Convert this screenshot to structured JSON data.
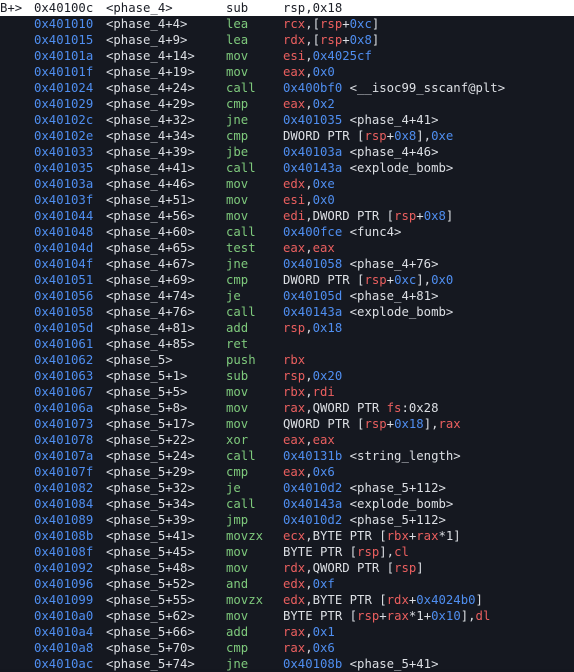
{
  "gutter_marker": "B+>",
  "lines": [
    {
      "addr": "0x40100c",
      "sym": "<phase_4>",
      "mn": "sub",
      "ops": [
        {
          "t": "rsp",
          "k": "plain"
        },
        {
          "t": ",",
          "k": "plain"
        },
        {
          "t": "0x18",
          "k": "plain"
        }
      ],
      "current": true
    },
    {
      "addr": "0x401010",
      "sym": "<phase_4+4>",
      "mn": "lea",
      "ops": [
        {
          "t": "rcx",
          "k": "reg"
        },
        {
          "t": ",[",
          "k": "plain"
        },
        {
          "t": "rsp",
          "k": "reg"
        },
        {
          "t": "+",
          "k": "plain"
        },
        {
          "t": "0xc",
          "k": "num"
        },
        {
          "t": "]",
          "k": "plain"
        }
      ]
    },
    {
      "addr": "0x401015",
      "sym": "<phase_4+9>",
      "mn": "lea",
      "ops": [
        {
          "t": "rdx",
          "k": "reg"
        },
        {
          "t": ",[",
          "k": "plain"
        },
        {
          "t": "rsp",
          "k": "reg"
        },
        {
          "t": "+",
          "k": "plain"
        },
        {
          "t": "0x8",
          "k": "num"
        },
        {
          "t": "]",
          "k": "plain"
        }
      ]
    },
    {
      "addr": "0x40101a",
      "sym": "<phase_4+14>",
      "mn": "mov",
      "ops": [
        {
          "t": "esi",
          "k": "reg"
        },
        {
          "t": ",",
          "k": "plain"
        },
        {
          "t": "0x4025cf",
          "k": "num"
        }
      ]
    },
    {
      "addr": "0x40101f",
      "sym": "<phase_4+19>",
      "mn": "mov",
      "ops": [
        {
          "t": "eax",
          "k": "reg"
        },
        {
          "t": ",",
          "k": "plain"
        },
        {
          "t": "0x0",
          "k": "num"
        }
      ]
    },
    {
      "addr": "0x401024",
      "sym": "<phase_4+24>",
      "mn": "call",
      "ops": [
        {
          "t": "0x400bf0",
          "k": "num"
        },
        {
          "t": " <__isoc99_sscanf@plt>",
          "k": "plain"
        }
      ]
    },
    {
      "addr": "0x401029",
      "sym": "<phase_4+29>",
      "mn": "cmp",
      "ops": [
        {
          "t": "eax",
          "k": "reg"
        },
        {
          "t": ",",
          "k": "plain"
        },
        {
          "t": "0x2",
          "k": "num"
        }
      ]
    },
    {
      "addr": "0x40102c",
      "sym": "<phase_4+32>",
      "mn": "jne",
      "ops": [
        {
          "t": "0x401035",
          "k": "num"
        },
        {
          "t": " <phase_4+41>",
          "k": "plain"
        }
      ]
    },
    {
      "addr": "0x40102e",
      "sym": "<phase_4+34>",
      "mn": "cmp",
      "ops": [
        {
          "t": "DWORD PTR [",
          "k": "plain"
        },
        {
          "t": "rsp",
          "k": "reg"
        },
        {
          "t": "+",
          "k": "plain"
        },
        {
          "t": "0x8",
          "k": "num"
        },
        {
          "t": "],",
          "k": "plain"
        },
        {
          "t": "0xe",
          "k": "num"
        }
      ]
    },
    {
      "addr": "0x401033",
      "sym": "<phase_4+39>",
      "mn": "jbe",
      "ops": [
        {
          "t": "0x40103a",
          "k": "num"
        },
        {
          "t": " <phase_4+46>",
          "k": "plain"
        }
      ]
    },
    {
      "addr": "0x401035",
      "sym": "<phase_4+41>",
      "mn": "call",
      "ops": [
        {
          "t": "0x40143a",
          "k": "num"
        },
        {
          "t": " <explode_bomb>",
          "k": "plain"
        }
      ]
    },
    {
      "addr": "0x40103a",
      "sym": "<phase_4+46>",
      "mn": "mov",
      "ops": [
        {
          "t": "edx",
          "k": "reg"
        },
        {
          "t": ",",
          "k": "plain"
        },
        {
          "t": "0xe",
          "k": "num"
        }
      ]
    },
    {
      "addr": "0x40103f",
      "sym": "<phase_4+51>",
      "mn": "mov",
      "ops": [
        {
          "t": "esi",
          "k": "reg"
        },
        {
          "t": ",",
          "k": "plain"
        },
        {
          "t": "0x0",
          "k": "num"
        }
      ]
    },
    {
      "addr": "0x401044",
      "sym": "<phase_4+56>",
      "mn": "mov",
      "ops": [
        {
          "t": "edi",
          "k": "reg"
        },
        {
          "t": ",DWORD PTR [",
          "k": "plain"
        },
        {
          "t": "rsp",
          "k": "reg"
        },
        {
          "t": "+",
          "k": "plain"
        },
        {
          "t": "0x8",
          "k": "num"
        },
        {
          "t": "]",
          "k": "plain"
        }
      ]
    },
    {
      "addr": "0x401048",
      "sym": "<phase_4+60>",
      "mn": "call",
      "ops": [
        {
          "t": "0x400fce",
          "k": "num"
        },
        {
          "t": " <func4>",
          "k": "plain"
        }
      ]
    },
    {
      "addr": "0x40104d",
      "sym": "<phase_4+65>",
      "mn": "test",
      "ops": [
        {
          "t": "eax",
          "k": "reg"
        },
        {
          "t": ",",
          "k": "plain"
        },
        {
          "t": "eax",
          "k": "reg"
        }
      ]
    },
    {
      "addr": "0x40104f",
      "sym": "<phase_4+67>",
      "mn": "jne",
      "ops": [
        {
          "t": "0x401058",
          "k": "num"
        },
        {
          "t": " <phase_4+76>",
          "k": "plain"
        }
      ]
    },
    {
      "addr": "0x401051",
      "sym": "<phase_4+69>",
      "mn": "cmp",
      "ops": [
        {
          "t": "DWORD PTR [",
          "k": "plain"
        },
        {
          "t": "rsp",
          "k": "reg"
        },
        {
          "t": "+",
          "k": "plain"
        },
        {
          "t": "0xc",
          "k": "num"
        },
        {
          "t": "],",
          "k": "plain"
        },
        {
          "t": "0x0",
          "k": "num"
        }
      ]
    },
    {
      "addr": "0x401056",
      "sym": "<phase_4+74>",
      "mn": "je",
      "ops": [
        {
          "t": "0x40105d",
          "k": "num"
        },
        {
          "t": " <phase_4+81>",
          "k": "plain"
        }
      ]
    },
    {
      "addr": "0x401058",
      "sym": "<phase_4+76>",
      "mn": "call",
      "ops": [
        {
          "t": "0x40143a",
          "k": "num"
        },
        {
          "t": " <explode_bomb>",
          "k": "plain"
        }
      ]
    },
    {
      "addr": "0x40105d",
      "sym": "<phase_4+81>",
      "mn": "add",
      "ops": [
        {
          "t": "rsp",
          "k": "reg"
        },
        {
          "t": ",",
          "k": "plain"
        },
        {
          "t": "0x18",
          "k": "num"
        }
      ]
    },
    {
      "addr": "0x401061",
      "sym": "<phase_4+85>",
      "mn": "ret",
      "ops": []
    },
    {
      "addr": "0x401062",
      "sym": "<phase_5>",
      "mn": "push",
      "ops": [
        {
          "t": "rbx",
          "k": "reg"
        }
      ]
    },
    {
      "addr": "0x401063",
      "sym": "<phase_5+1>",
      "mn": "sub",
      "ops": [
        {
          "t": "rsp",
          "k": "reg"
        },
        {
          "t": ",",
          "k": "plain"
        },
        {
          "t": "0x20",
          "k": "num"
        }
      ]
    },
    {
      "addr": "0x401067",
      "sym": "<phase_5+5>",
      "mn": "mov",
      "ops": [
        {
          "t": "rbx",
          "k": "reg"
        },
        {
          "t": ",",
          "k": "plain"
        },
        {
          "t": "rdi",
          "k": "reg"
        }
      ]
    },
    {
      "addr": "0x40106a",
      "sym": "<phase_5+8>",
      "mn": "mov",
      "ops": [
        {
          "t": "rax",
          "k": "reg"
        },
        {
          "t": ",QWORD PTR ",
          "k": "plain"
        },
        {
          "t": "fs",
          "k": "reg"
        },
        {
          "t": ":0x28",
          "k": "plain"
        }
      ]
    },
    {
      "addr": "0x401073",
      "sym": "<phase_5+17>",
      "mn": "mov",
      "ops": [
        {
          "t": "QWORD PTR [",
          "k": "plain"
        },
        {
          "t": "rsp",
          "k": "reg"
        },
        {
          "t": "+",
          "k": "plain"
        },
        {
          "t": "0x18",
          "k": "num"
        },
        {
          "t": "],",
          "k": "plain"
        },
        {
          "t": "rax",
          "k": "reg"
        }
      ]
    },
    {
      "addr": "0x401078",
      "sym": "<phase_5+22>",
      "mn": "xor",
      "ops": [
        {
          "t": "eax",
          "k": "reg"
        },
        {
          "t": ",",
          "k": "plain"
        },
        {
          "t": "eax",
          "k": "reg"
        }
      ]
    },
    {
      "addr": "0x40107a",
      "sym": "<phase_5+24>",
      "mn": "call",
      "ops": [
        {
          "t": "0x40131b",
          "k": "num"
        },
        {
          "t": " <string_length>",
          "k": "plain"
        }
      ]
    },
    {
      "addr": "0x40107f",
      "sym": "<phase_5+29>",
      "mn": "cmp",
      "ops": [
        {
          "t": "eax",
          "k": "reg"
        },
        {
          "t": ",",
          "k": "plain"
        },
        {
          "t": "0x6",
          "k": "num"
        }
      ]
    },
    {
      "addr": "0x401082",
      "sym": "<phase_5+32>",
      "mn": "je",
      "ops": [
        {
          "t": "0x4010d2",
          "k": "num"
        },
        {
          "t": " <phase_5+112>",
          "k": "plain"
        }
      ]
    },
    {
      "addr": "0x401084",
      "sym": "<phase_5+34>",
      "mn": "call",
      "ops": [
        {
          "t": "0x40143a",
          "k": "num"
        },
        {
          "t": " <explode_bomb>",
          "k": "plain"
        }
      ]
    },
    {
      "addr": "0x401089",
      "sym": "<phase_5+39>",
      "mn": "jmp",
      "ops": [
        {
          "t": "0x4010d2",
          "k": "num"
        },
        {
          "t": " <phase_5+112>",
          "k": "plain"
        }
      ]
    },
    {
      "addr": "0x40108b",
      "sym": "<phase_5+41>",
      "mn": "movzx",
      "ops": [
        {
          "t": "ecx",
          "k": "reg"
        },
        {
          "t": ",BYTE PTR [",
          "k": "plain"
        },
        {
          "t": "rbx",
          "k": "reg"
        },
        {
          "t": "+",
          "k": "plain"
        },
        {
          "t": "rax",
          "k": "reg"
        },
        {
          "t": "*1]",
          "k": "plain"
        }
      ]
    },
    {
      "addr": "0x40108f",
      "sym": "<phase_5+45>",
      "mn": "mov",
      "ops": [
        {
          "t": "BYTE PTR [",
          "k": "plain"
        },
        {
          "t": "rsp",
          "k": "reg"
        },
        {
          "t": "],",
          "k": "plain"
        },
        {
          "t": "cl",
          "k": "reg"
        }
      ]
    },
    {
      "addr": "0x401092",
      "sym": "<phase_5+48>",
      "mn": "mov",
      "ops": [
        {
          "t": "rdx",
          "k": "reg"
        },
        {
          "t": ",QWORD PTR [",
          "k": "plain"
        },
        {
          "t": "rsp",
          "k": "reg"
        },
        {
          "t": "]",
          "k": "plain"
        }
      ]
    },
    {
      "addr": "0x401096",
      "sym": "<phase_5+52>",
      "mn": "and",
      "ops": [
        {
          "t": "edx",
          "k": "reg"
        },
        {
          "t": ",",
          "k": "plain"
        },
        {
          "t": "0xf",
          "k": "num"
        }
      ]
    },
    {
      "addr": "0x401099",
      "sym": "<phase_5+55>",
      "mn": "movzx",
      "ops": [
        {
          "t": "edx",
          "k": "reg"
        },
        {
          "t": ",BYTE PTR [",
          "k": "plain"
        },
        {
          "t": "rdx",
          "k": "reg"
        },
        {
          "t": "+",
          "k": "plain"
        },
        {
          "t": "0x4024b0",
          "k": "num"
        },
        {
          "t": "]",
          "k": "plain"
        }
      ]
    },
    {
      "addr": "0x4010a0",
      "sym": "<phase_5+62>",
      "mn": "mov",
      "ops": [
        {
          "t": "BYTE PTR [",
          "k": "plain"
        },
        {
          "t": "rsp",
          "k": "reg"
        },
        {
          "t": "+",
          "k": "plain"
        },
        {
          "t": "rax",
          "k": "reg"
        },
        {
          "t": "*1+",
          "k": "plain"
        },
        {
          "t": "0x10",
          "k": "num"
        },
        {
          "t": "],",
          "k": "plain"
        },
        {
          "t": "dl",
          "k": "reg"
        }
      ]
    },
    {
      "addr": "0x4010a4",
      "sym": "<phase_5+66>",
      "mn": "add",
      "ops": [
        {
          "t": "rax",
          "k": "reg"
        },
        {
          "t": ",",
          "k": "plain"
        },
        {
          "t": "0x1",
          "k": "num"
        }
      ]
    },
    {
      "addr": "0x4010a8",
      "sym": "<phase_5+70>",
      "mn": "cmp",
      "ops": [
        {
          "t": "rax",
          "k": "reg"
        },
        {
          "t": ",",
          "k": "plain"
        },
        {
          "t": "0x6",
          "k": "num"
        }
      ]
    },
    {
      "addr": "0x4010ac",
      "sym": "<phase_5+74>",
      "mn": "jne",
      "ops": [
        {
          "t": "0x40108b",
          "k": "num"
        },
        {
          "t": " <phase_5+41>",
          "k": "plain"
        }
      ]
    }
  ],
  "colors": {
    "background": "#151820",
    "address": "#4f8ef0",
    "mnemonic": "#7ec97c",
    "register": "#ea5f5f",
    "highlight": "#ffffff"
  }
}
